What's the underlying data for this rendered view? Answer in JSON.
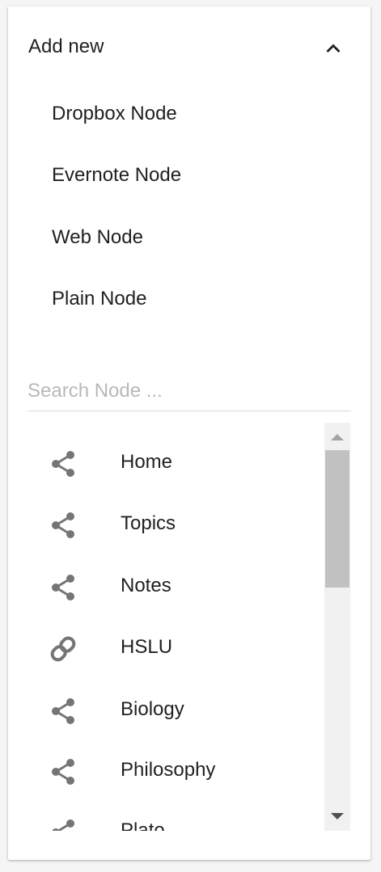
{
  "panel": {
    "header_title": "Add new",
    "expanded": true
  },
  "add_items": [
    {
      "label": "Dropbox Node"
    },
    {
      "label": "Evernote Node"
    },
    {
      "label": "Web Node"
    },
    {
      "label": "Plain Node"
    }
  ],
  "search": {
    "placeholder": "Search Node ...",
    "value": ""
  },
  "nodes": [
    {
      "label": "Home",
      "icon": "share-icon"
    },
    {
      "label": "Topics",
      "icon": "share-icon"
    },
    {
      "label": "Notes",
      "icon": "share-icon"
    },
    {
      "label": "HSLU",
      "icon": "link-icon"
    },
    {
      "label": "Biology",
      "icon": "share-icon"
    },
    {
      "label": "Philosophy",
      "icon": "share-icon"
    },
    {
      "label": "Plato",
      "icon": "share-icon"
    }
  ],
  "colors": {
    "text": "#212121",
    "icon": "#757575",
    "placeholder": "#b8b8b8"
  }
}
